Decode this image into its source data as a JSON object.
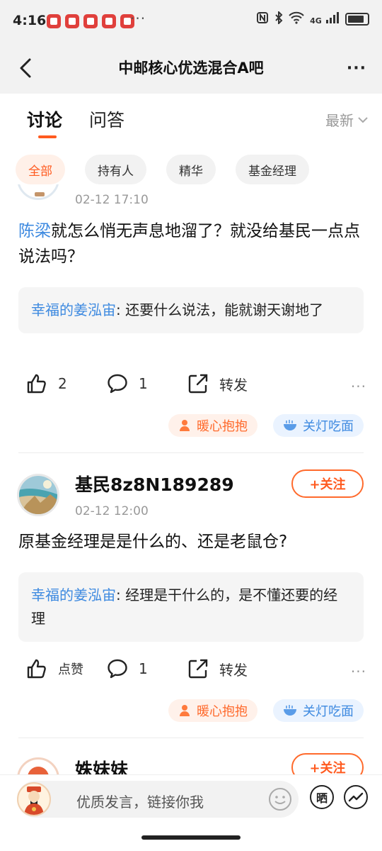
{
  "status_bar": {
    "time": "4:16",
    "more": "···",
    "icons": [
      "nfc-icon",
      "bluetooth-icon",
      "wifi-icon",
      "signal-4g-icon",
      "battery-icon"
    ],
    "signal_label": "4G"
  },
  "header": {
    "title": "中邮核心优选混合A吧",
    "more": "···"
  },
  "tabs": [
    {
      "label": "讨论",
      "active": true
    },
    {
      "label": "问答",
      "active": false
    }
  ],
  "sort": {
    "label": "最新"
  },
  "filters": [
    {
      "label": "全部",
      "active": true
    },
    {
      "label": "持有人",
      "active": false
    },
    {
      "label": "精华",
      "active": false
    },
    {
      "label": "基金经理",
      "active": false
    }
  ],
  "posts": [
    {
      "time": "02-12 17:10",
      "mention": "陈梁",
      "text": "就怎么悄无声息地溜了？就没给基民一点点说法吗？",
      "reply_user": "幸福的姜泓宙",
      "reply_text": ": 还要什么说法，能就谢天谢地了",
      "likes": "2",
      "comments": "1",
      "share_label": "转发",
      "more": "···",
      "tags": [
        "暖心抱抱",
        "关灯吃面"
      ]
    },
    {
      "username": "基民8z8N189289",
      "time": "02-12 12:00",
      "follow_label": "+关注",
      "text": "原基金经理是是什么的、还是老鼠仓?",
      "reply_user": "幸福的姜泓宙",
      "reply_text": ": 经理是干什么的，是不懂还要的经理",
      "likes": "点赞",
      "comments": "1",
      "share_label": "转发",
      "more": "···",
      "tags": [
        "暖心抱抱",
        "关灯吃面"
      ]
    },
    {
      "username": "姝妹妹",
      "follow_label": "+关注"
    }
  ],
  "bottom_bar": {
    "placeholder": "优质发言，链接你我",
    "shai_label": "晒"
  },
  "colors": {
    "accent": "#ff5a1f",
    "link": "#3e8ae0",
    "background": "#ffffff",
    "header_bg": "#f2f2f2"
  }
}
